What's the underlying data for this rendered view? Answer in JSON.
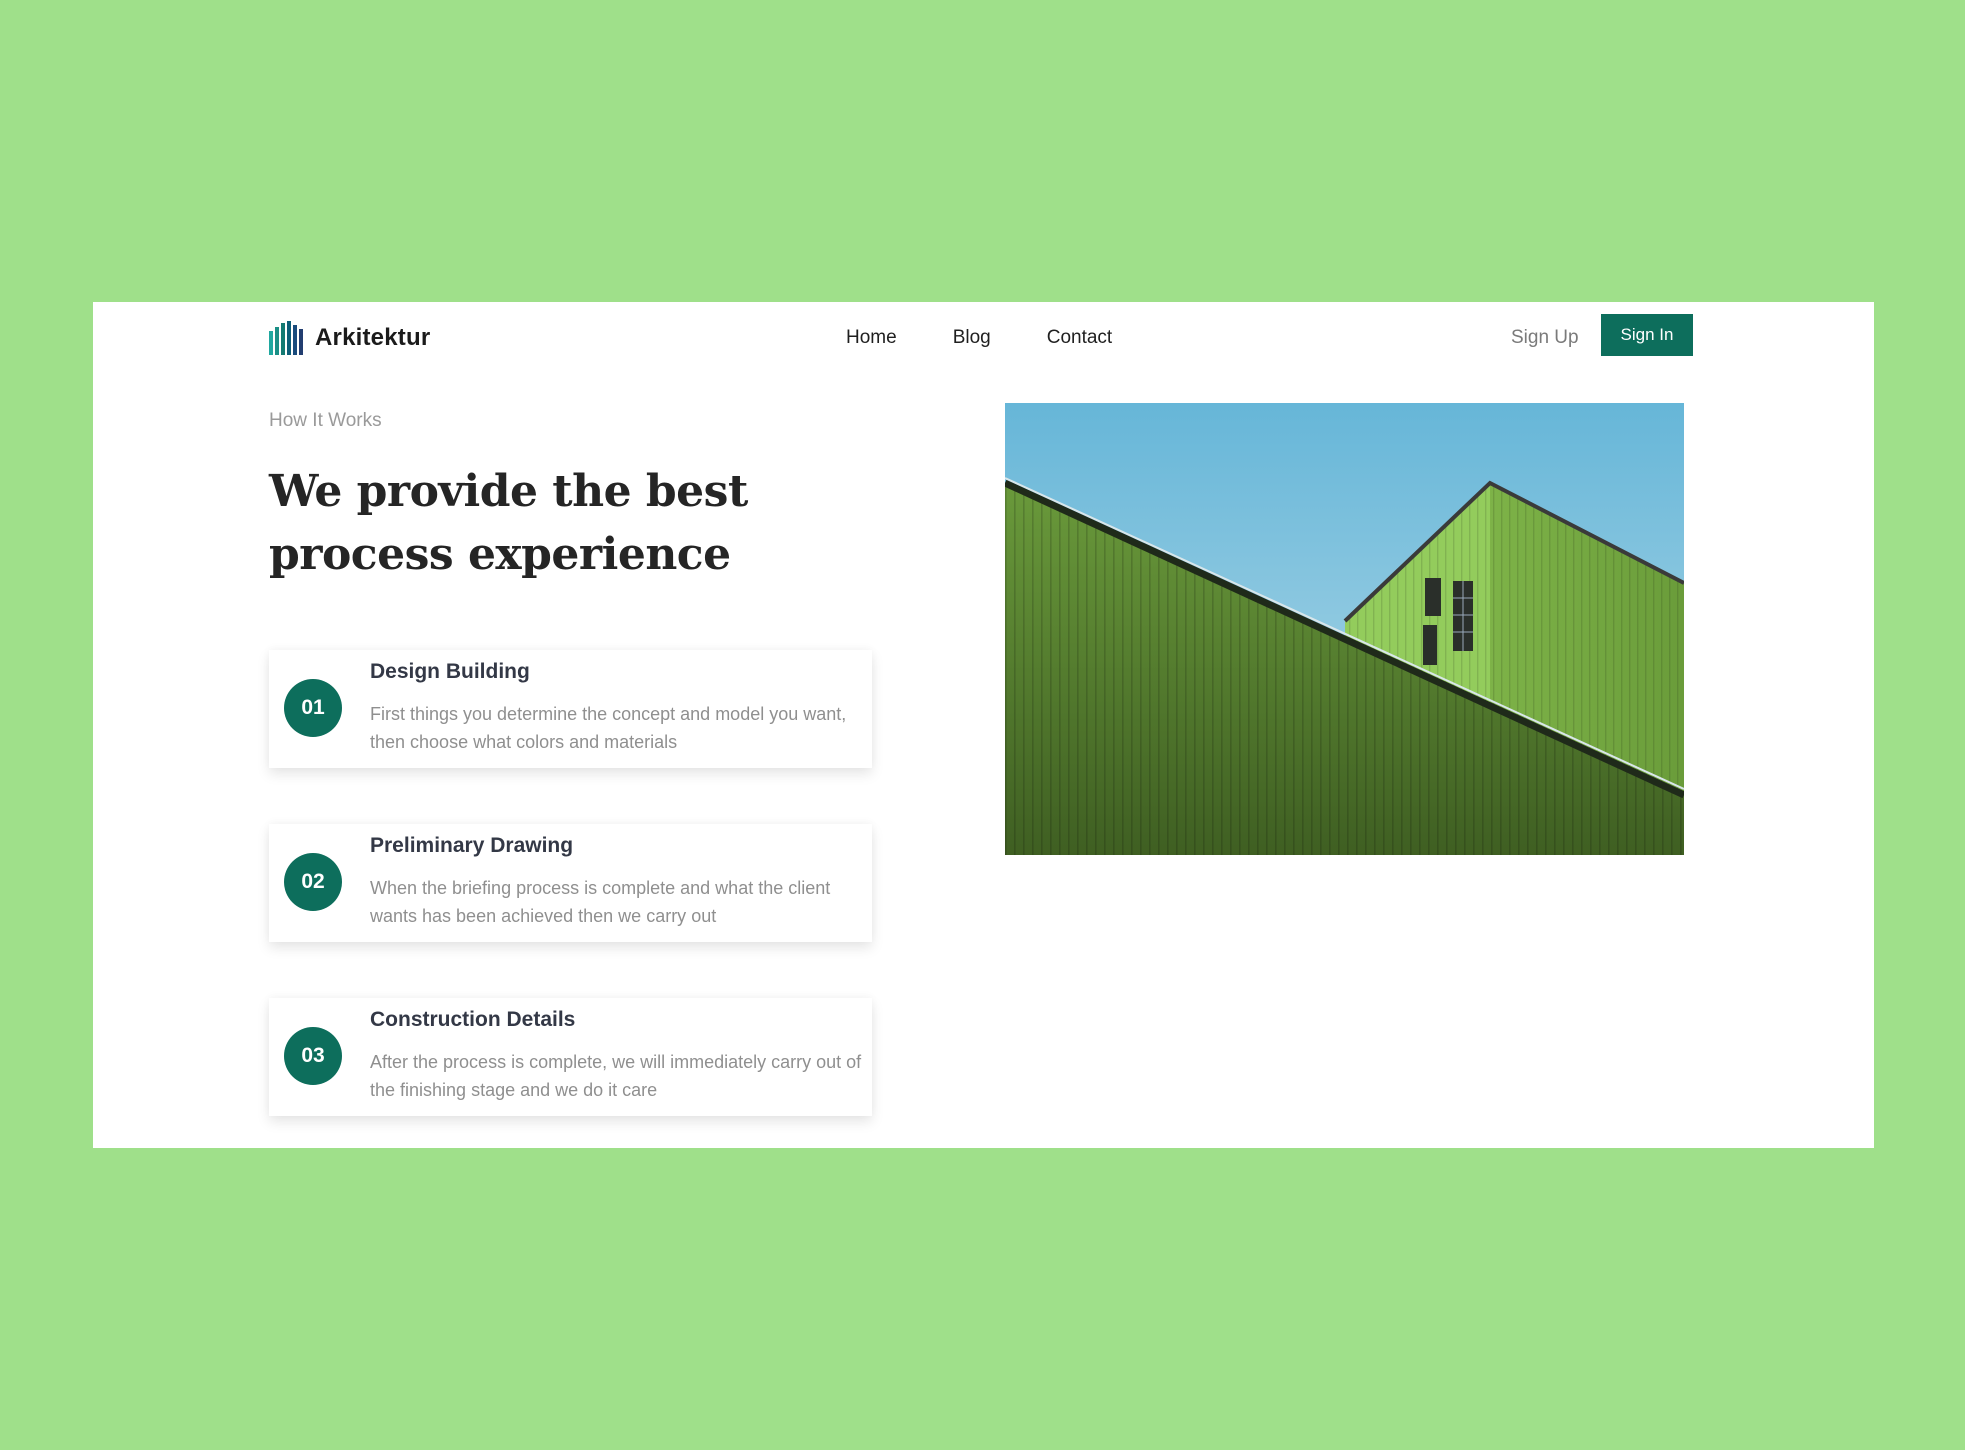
{
  "brand": {
    "name": "Arkitektur",
    "logo_icon": "building-bars-icon",
    "colors": {
      "accent": "#0d6e5c",
      "page_background": "#9fe08a"
    }
  },
  "nav": {
    "links": [
      "Home",
      "Blog",
      "Contact"
    ]
  },
  "auth": {
    "sign_up": "Sign Up",
    "sign_in": "Sign In"
  },
  "section": {
    "eyebrow": "How It Works",
    "headline": "We provide the best process experience"
  },
  "steps": [
    {
      "number": "01",
      "title": "Design Building",
      "description": "First things you determine the concept and model you want, then choose what colors and materials"
    },
    {
      "number": "02",
      "title": "Preliminary Drawing",
      "description": "When the briefing process is complete and what the client wants has been achieved then we carry out"
    },
    {
      "number": "03",
      "title": "Construction Details",
      "description": "After the process is complete, we will immediately carry out of the finishing stage and we do it care"
    }
  ],
  "hero_image": {
    "subject": "green corrugated building against blue sky"
  }
}
